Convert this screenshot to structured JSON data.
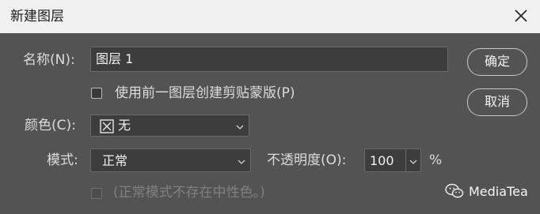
{
  "dialog": {
    "title": "新建图层",
    "close_icon": "close-icon"
  },
  "fields": {
    "name_label": "名称(N):",
    "name_value": "图层 1",
    "clip_checkbox_label": "使用前一图层创建剪贴蒙版(P)",
    "clip_checked": false,
    "color_label": "颜色(C):",
    "color_value": "无",
    "color_swatch_icon": "no-color-x-icon",
    "mode_label": "模式:",
    "mode_value": "正常",
    "opacity_label": "不透明度(O):",
    "opacity_value": "100",
    "opacity_unit": "%",
    "neutral_checkbox_label": "(正常模式不存在中性色。)",
    "neutral_checked": false,
    "neutral_disabled": true
  },
  "buttons": {
    "ok": "确定",
    "cancel": "取消"
  },
  "watermark": {
    "text": "MediaTea",
    "icon": "wechat-icon"
  },
  "colors": {
    "dialog_bg": "#535353",
    "titlebar_bg": "#f0f0f0",
    "field_bg": "#3d3d3d"
  }
}
